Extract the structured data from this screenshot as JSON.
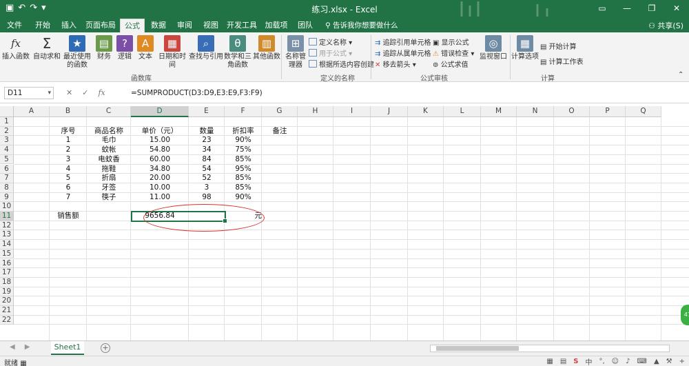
{
  "window": {
    "title": "练习.xlsx - Excel",
    "share": "共享(S)"
  },
  "tabs": [
    {
      "label": "文件"
    },
    {
      "label": "开始"
    },
    {
      "label": "插入"
    },
    {
      "label": "页面布局"
    },
    {
      "label": "公式"
    },
    {
      "label": "数据"
    },
    {
      "label": "审阅"
    },
    {
      "label": "视图"
    },
    {
      "label": "开发工具"
    },
    {
      "label": "加载项"
    },
    {
      "label": "团队"
    }
  ],
  "tell_me": "告诉我你想要做什么",
  "ribbon": {
    "insert_function": "插入函数",
    "autosum": "自动求和",
    "recent": "最近使用的函数",
    "financial": "财务",
    "logical": "逻辑",
    "text": "文本",
    "datetime": "日期和时间",
    "lookup": "查找与引用",
    "math": "数学和三角函数",
    "more": "其他函数",
    "group_library": "函数库",
    "name_manager": "名称管理器",
    "define_name": "定义名称",
    "use_in_formula": "用于公式",
    "create_from_selection": "根据所选内容创建",
    "group_names": "定义的名称",
    "trace_precedents": "追踪引用单元格",
    "trace_dependents": "追踪从属单元格",
    "remove_arrows": "移去箭头",
    "show_formulas": "显示公式",
    "error_checking": "错误检查",
    "evaluate": "公式求值",
    "group_audit": "公式审核",
    "watch_window": "监视窗口",
    "calc_options": "计算选项",
    "calc_now": "开始计算",
    "calc_sheet": "计算工作表",
    "group_calc": "计算"
  },
  "formula_bar": {
    "name_box": "D11",
    "cancel": "✕",
    "enter": "✓",
    "fx": "fx",
    "formula": "=SUMPRODUCT(D3:D9,E3:E9,F3:F9)"
  },
  "columns": [
    "A",
    "B",
    "C",
    "D",
    "E",
    "F",
    "G",
    "H",
    "I",
    "J",
    "K",
    "L",
    "M",
    "N",
    "O",
    "P",
    "Q"
  ],
  "rows": [
    "1",
    "2",
    "3",
    "4",
    "5",
    "6",
    "7",
    "8",
    "9",
    "10",
    "11",
    "12",
    "13",
    "14",
    "15",
    "16",
    "17",
    "18",
    "19",
    "20",
    "21",
    "22"
  ],
  "table": {
    "headers": [
      "序号",
      "商品名称",
      "单价（元）",
      "数量",
      "折扣率",
      "备注"
    ],
    "data": [
      [
        "1",
        "毛巾",
        "15.00",
        "23",
        "90%"
      ],
      [
        "2",
        "蚊帐",
        "54.80",
        "34",
        "75%"
      ],
      [
        "3",
        "电蚊香",
        "60.00",
        "84",
        "85%"
      ],
      [
        "4",
        "拖鞋",
        "34.80",
        "54",
        "95%"
      ],
      [
        "5",
        "折扇",
        "20.00",
        "52",
        "85%"
      ],
      [
        "6",
        "牙签",
        "10.00",
        "3",
        "85%"
      ],
      [
        "7",
        "筷子",
        "11.00",
        "98",
        "90%"
      ]
    ],
    "sales_label": "销售额",
    "sales_value": "9656.84",
    "unit": "元"
  },
  "sheet_tab": "Sheet1",
  "status": "就绪",
  "colors": {
    "brand": "#217346",
    "annotation": "#d9332f"
  }
}
